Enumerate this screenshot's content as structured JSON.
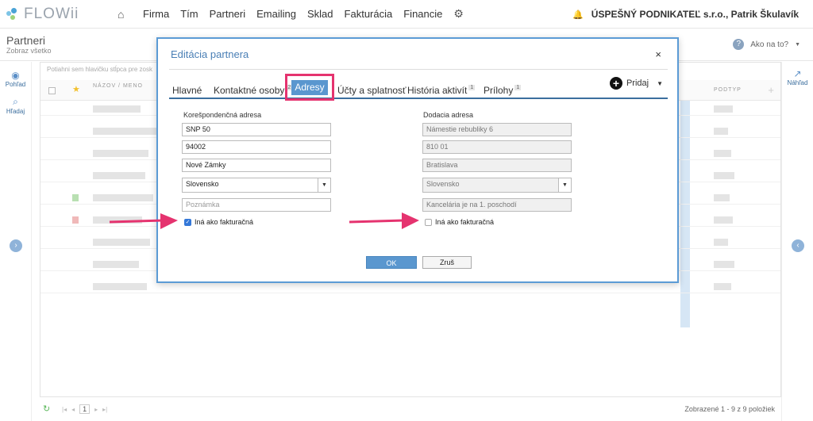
{
  "app": {
    "name": "FLOWii"
  },
  "nav": {
    "items": [
      "Firma",
      "Tím",
      "Partneri",
      "Emailing",
      "Sklad",
      "Fakturácia",
      "Financie"
    ],
    "company": "ÚSPEŠNÝ PODNIKATEĽ s.r.o., Patrik Škulavík"
  },
  "page": {
    "title": "Partneri",
    "subtitle": "Zobraz všetko",
    "help": "Ako na to?"
  },
  "sidebar": {
    "view_label": "Pohľad",
    "search_label": "Hľadaj",
    "preview_label": "Náhľad"
  },
  "grid": {
    "hint": "Potiahni sem hlavičku stĺpca pre zosk",
    "col_name": "NÁZOV / MENO",
    "col_type": "PODTYP"
  },
  "footer": {
    "page": "1",
    "info": "Zobrazené 1 - 9 z 9 položiek"
  },
  "modal": {
    "title": "Editácia partnera",
    "close": "×",
    "tabs": {
      "main": "Hlavné",
      "contacts": "Kontaktné osoby",
      "contacts_badge": "2",
      "addresses": "Adresy",
      "accounts": "Účty a splatnosť",
      "history": "História aktivít",
      "history_badge": "1",
      "attachments": "Prílohy",
      "attachments_badge": "1"
    },
    "add_label": "Pridaj",
    "correspondence": {
      "title": "Korešpondenčná adresa",
      "street": "SNP 50",
      "zip": "94002",
      "city": "Nové Zámky",
      "country": "Slovensko",
      "note_placeholder": "Poznámka",
      "checkbox_label": "Iná ako fakturačná",
      "checked": true
    },
    "delivery": {
      "title": "Dodacia adresa",
      "street": "Námestie rebubliky 6",
      "zip": "810 01",
      "city": "Bratislava",
      "country": "Slovensko",
      "note": "Kancelária je na 1. poschodí",
      "checkbox_label": "Iná ako fakturačná",
      "checked": false
    },
    "ok_label": "OK",
    "cancel_label": "Zruš"
  },
  "colors": {
    "accent": "#5a97cf",
    "highlight": "#e5336f",
    "title_blue": "#4a7fb5"
  }
}
